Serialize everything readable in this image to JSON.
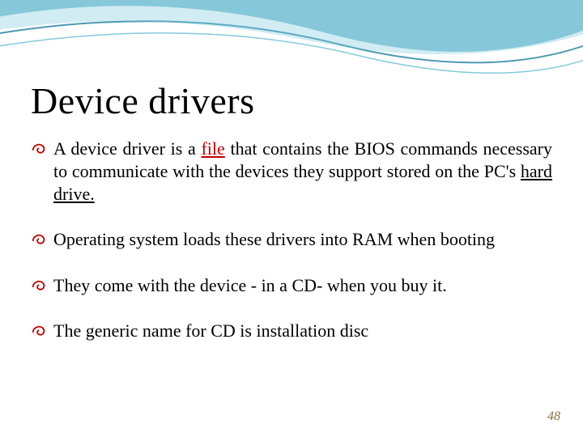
{
  "title": "Device drivers",
  "bullets": [
    {
      "pre": "A device driver is a ",
      "file_word": "file",
      "mid": " that contains the BIOS commands necessary to communicate with the devices they support stored on the PC's ",
      "hd_word": "hard drive.",
      "post": "",
      "justify": true
    },
    {
      "text": "Operating system loads these drivers into RAM when booting",
      "justify": true
    },
    {
      "text": "They come with the device - in a CD- when you buy it.",
      "justify": false
    },
    {
      "text": "The generic name for CD is installation disc",
      "justify": false
    }
  ],
  "page_number": "48",
  "icons": {
    "bullet_glyph": "swirl-icon"
  }
}
